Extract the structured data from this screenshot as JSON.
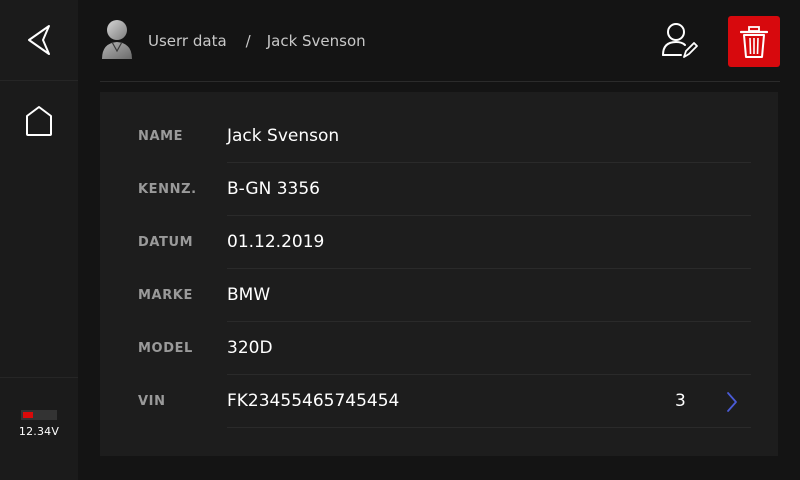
{
  "sidebar": {
    "back_icon": "back-arrow-icon",
    "home_icon": "home-icon",
    "battery": {
      "voltage": "12.34V",
      "level": 0.3,
      "color": "#d90a0a"
    }
  },
  "header": {
    "avatar_icon": "user-avatar-icon",
    "breadcrumb": {
      "parent": "Userr data",
      "separator": "/",
      "current": "Jack Svenson"
    },
    "edit_icon": "user-edit-icon",
    "delete_icon": "trash-icon",
    "delete_color": "#d7090d"
  },
  "details": {
    "rows": [
      {
        "label": "NAME",
        "value": "Jack Svenson"
      },
      {
        "label": "KENNZ.",
        "value": "B-GN 3356"
      },
      {
        "label": "DATUM",
        "value": "01.12.2019"
      },
      {
        "label": "MARKE",
        "value": "BMW"
      },
      {
        "label": "MODEL",
        "value": "320D"
      },
      {
        "label": "VIN",
        "value": "FK23455465745454",
        "count": "3",
        "chevron_icon": "chevron-right-icon",
        "accent": "#4a5bd6"
      }
    ]
  }
}
